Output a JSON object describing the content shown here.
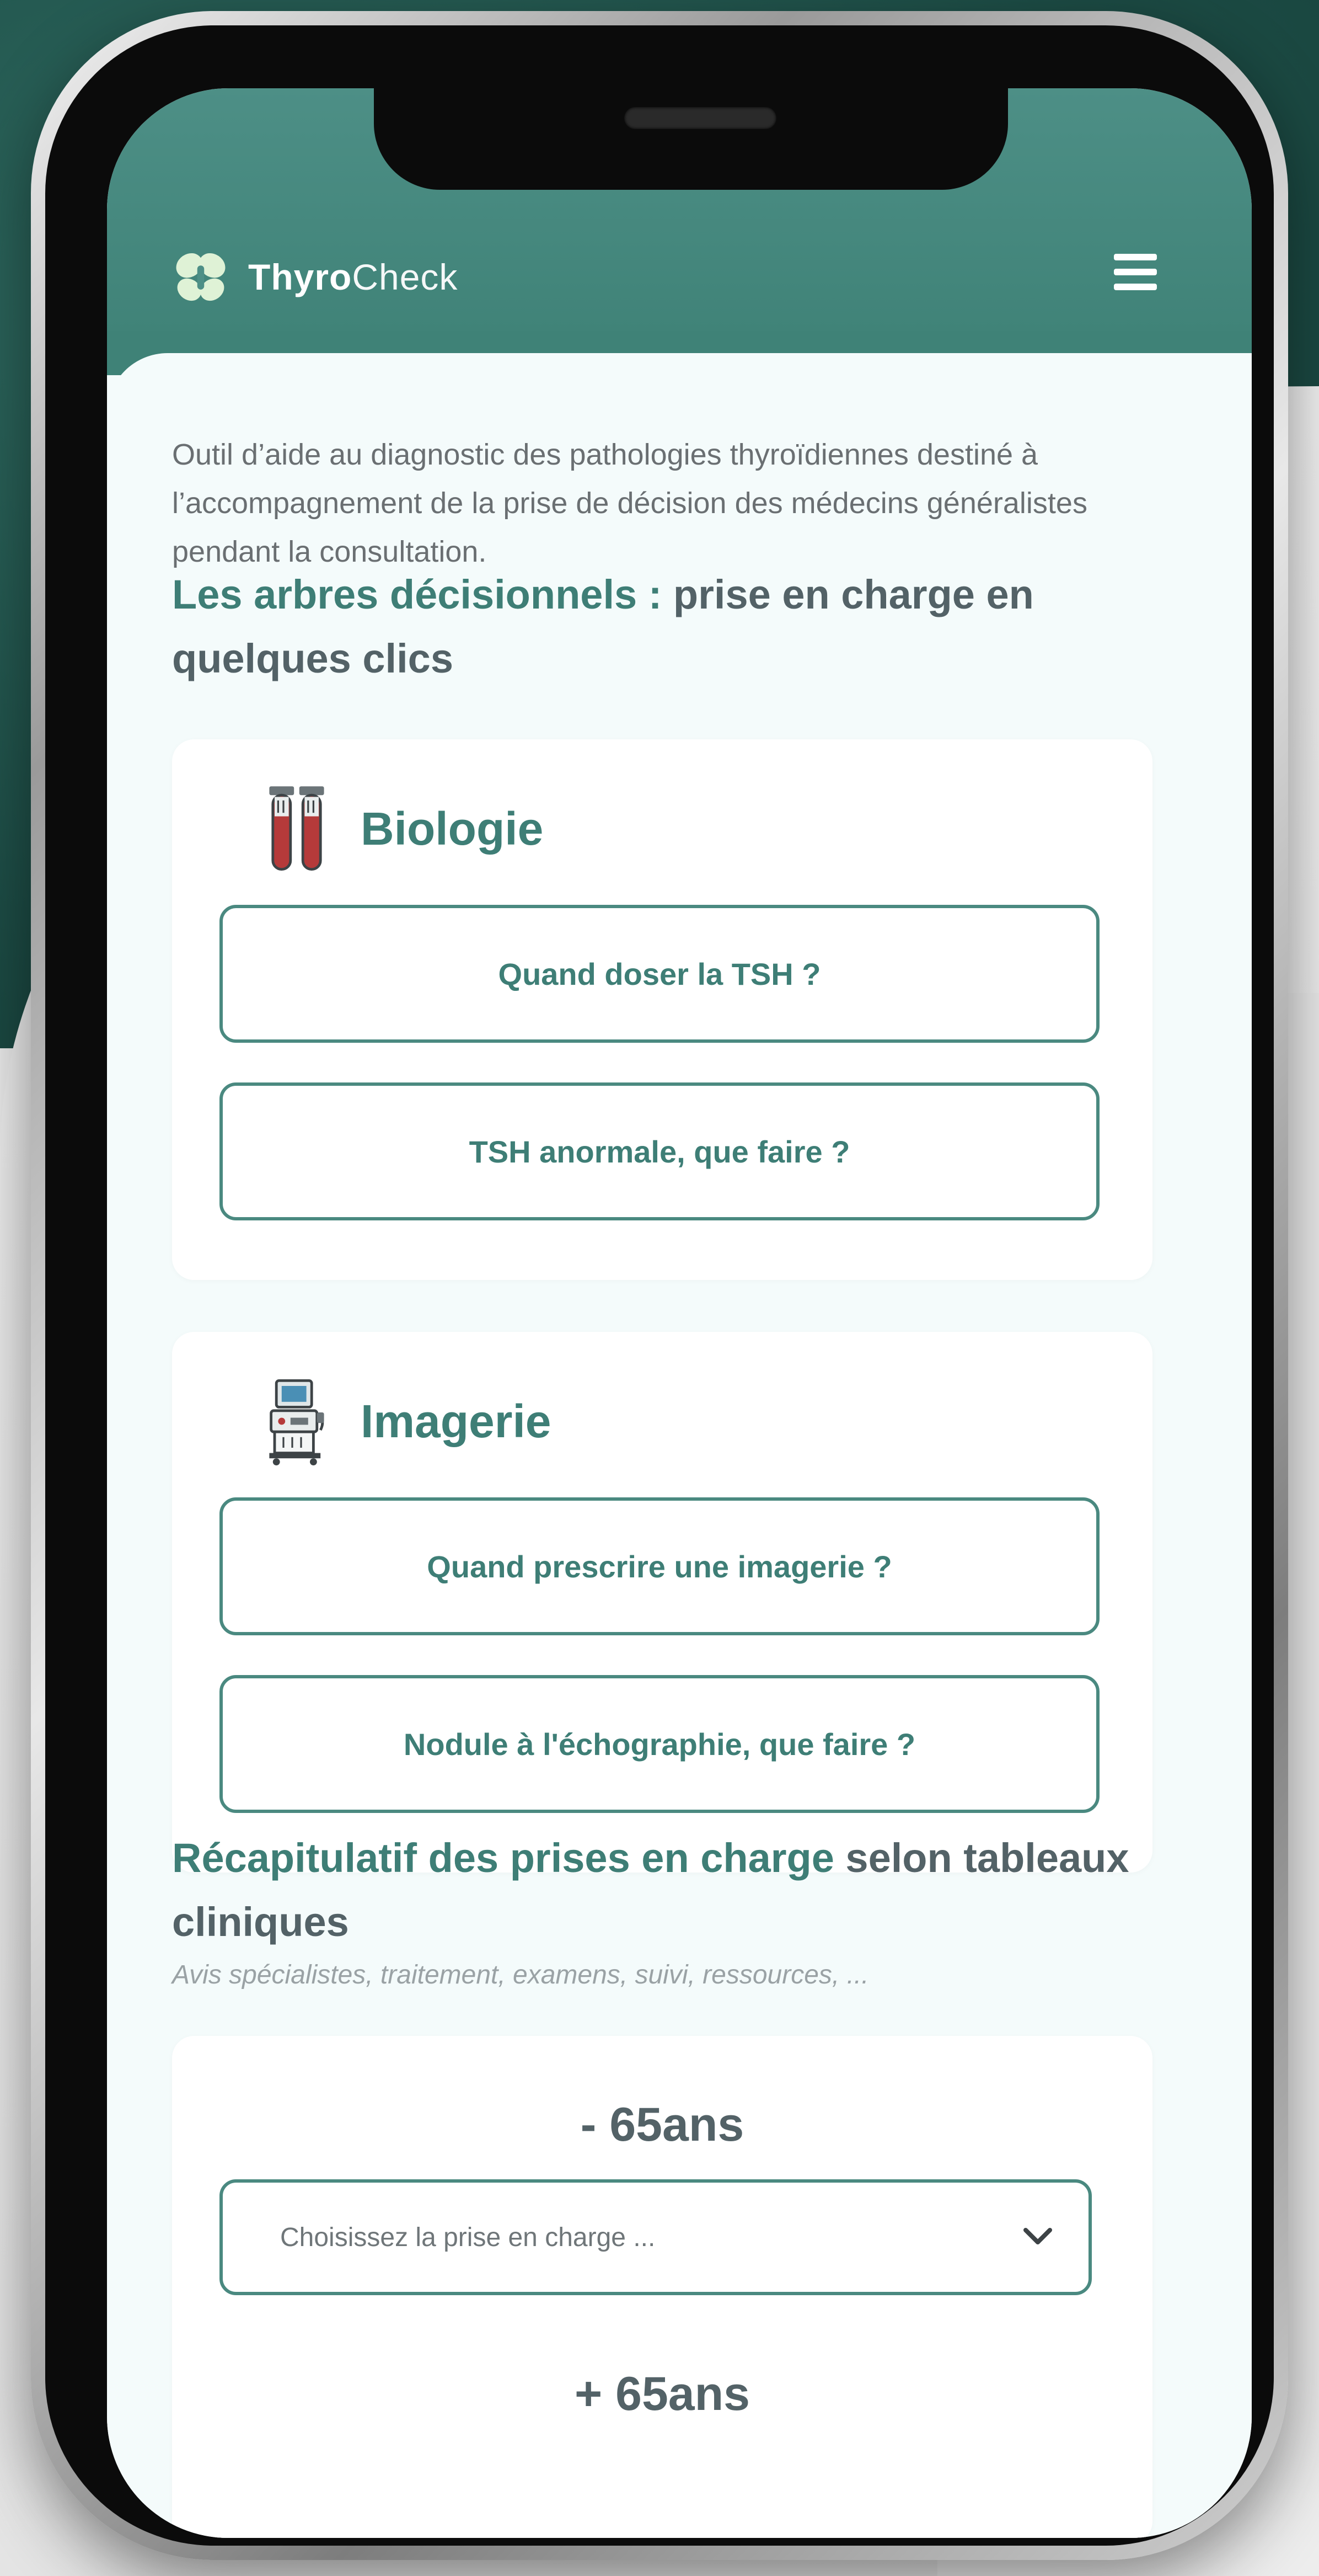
{
  "app": {
    "name_strong": "Thyro",
    "name_light": "Check"
  },
  "intro": "Outil d’aide au diagnostic des pathologies thyroïdiennes destiné à l’accompagnement de la prise de décision des médecins généralistes pendant la consultation.",
  "trees_section": {
    "title_strong": "Les arbres décisionnels :",
    "title_rest": " prise en charge en quelques clics"
  },
  "cards": [
    {
      "title": "Biologie",
      "icon": "test-tubes-icon",
      "buttons": [
        "Quand doser la TSH ?",
        "TSH anormale, que faire ?"
      ]
    },
    {
      "title": "Imagerie",
      "icon": "ultrasound-machine-icon",
      "buttons": [
        "Quand prescrire une imagerie ?",
        "Nodule à l'échographie, que faire ?"
      ]
    }
  ],
  "recap_section": {
    "title_strong": "Récapitulatif des prises en charge",
    "title_rest": " selon tableaux cliniques",
    "subtitle": "Avis spécialistes, traitement, examens, suivi, ressources, ..."
  },
  "recap_card": {
    "age_under": "- 65ans",
    "select_placeholder": "Choisissez la prise en charge ...",
    "age_over": "+ 65ans"
  },
  "colors": {
    "brand": "#3e7e76",
    "header": "#4d8f86",
    "tube_red": "#b53a3a"
  },
  "icons": {
    "logo": "butterfly-logo-icon",
    "menu": "hamburger-menu-icon",
    "select": "chevron-down-icon"
  }
}
